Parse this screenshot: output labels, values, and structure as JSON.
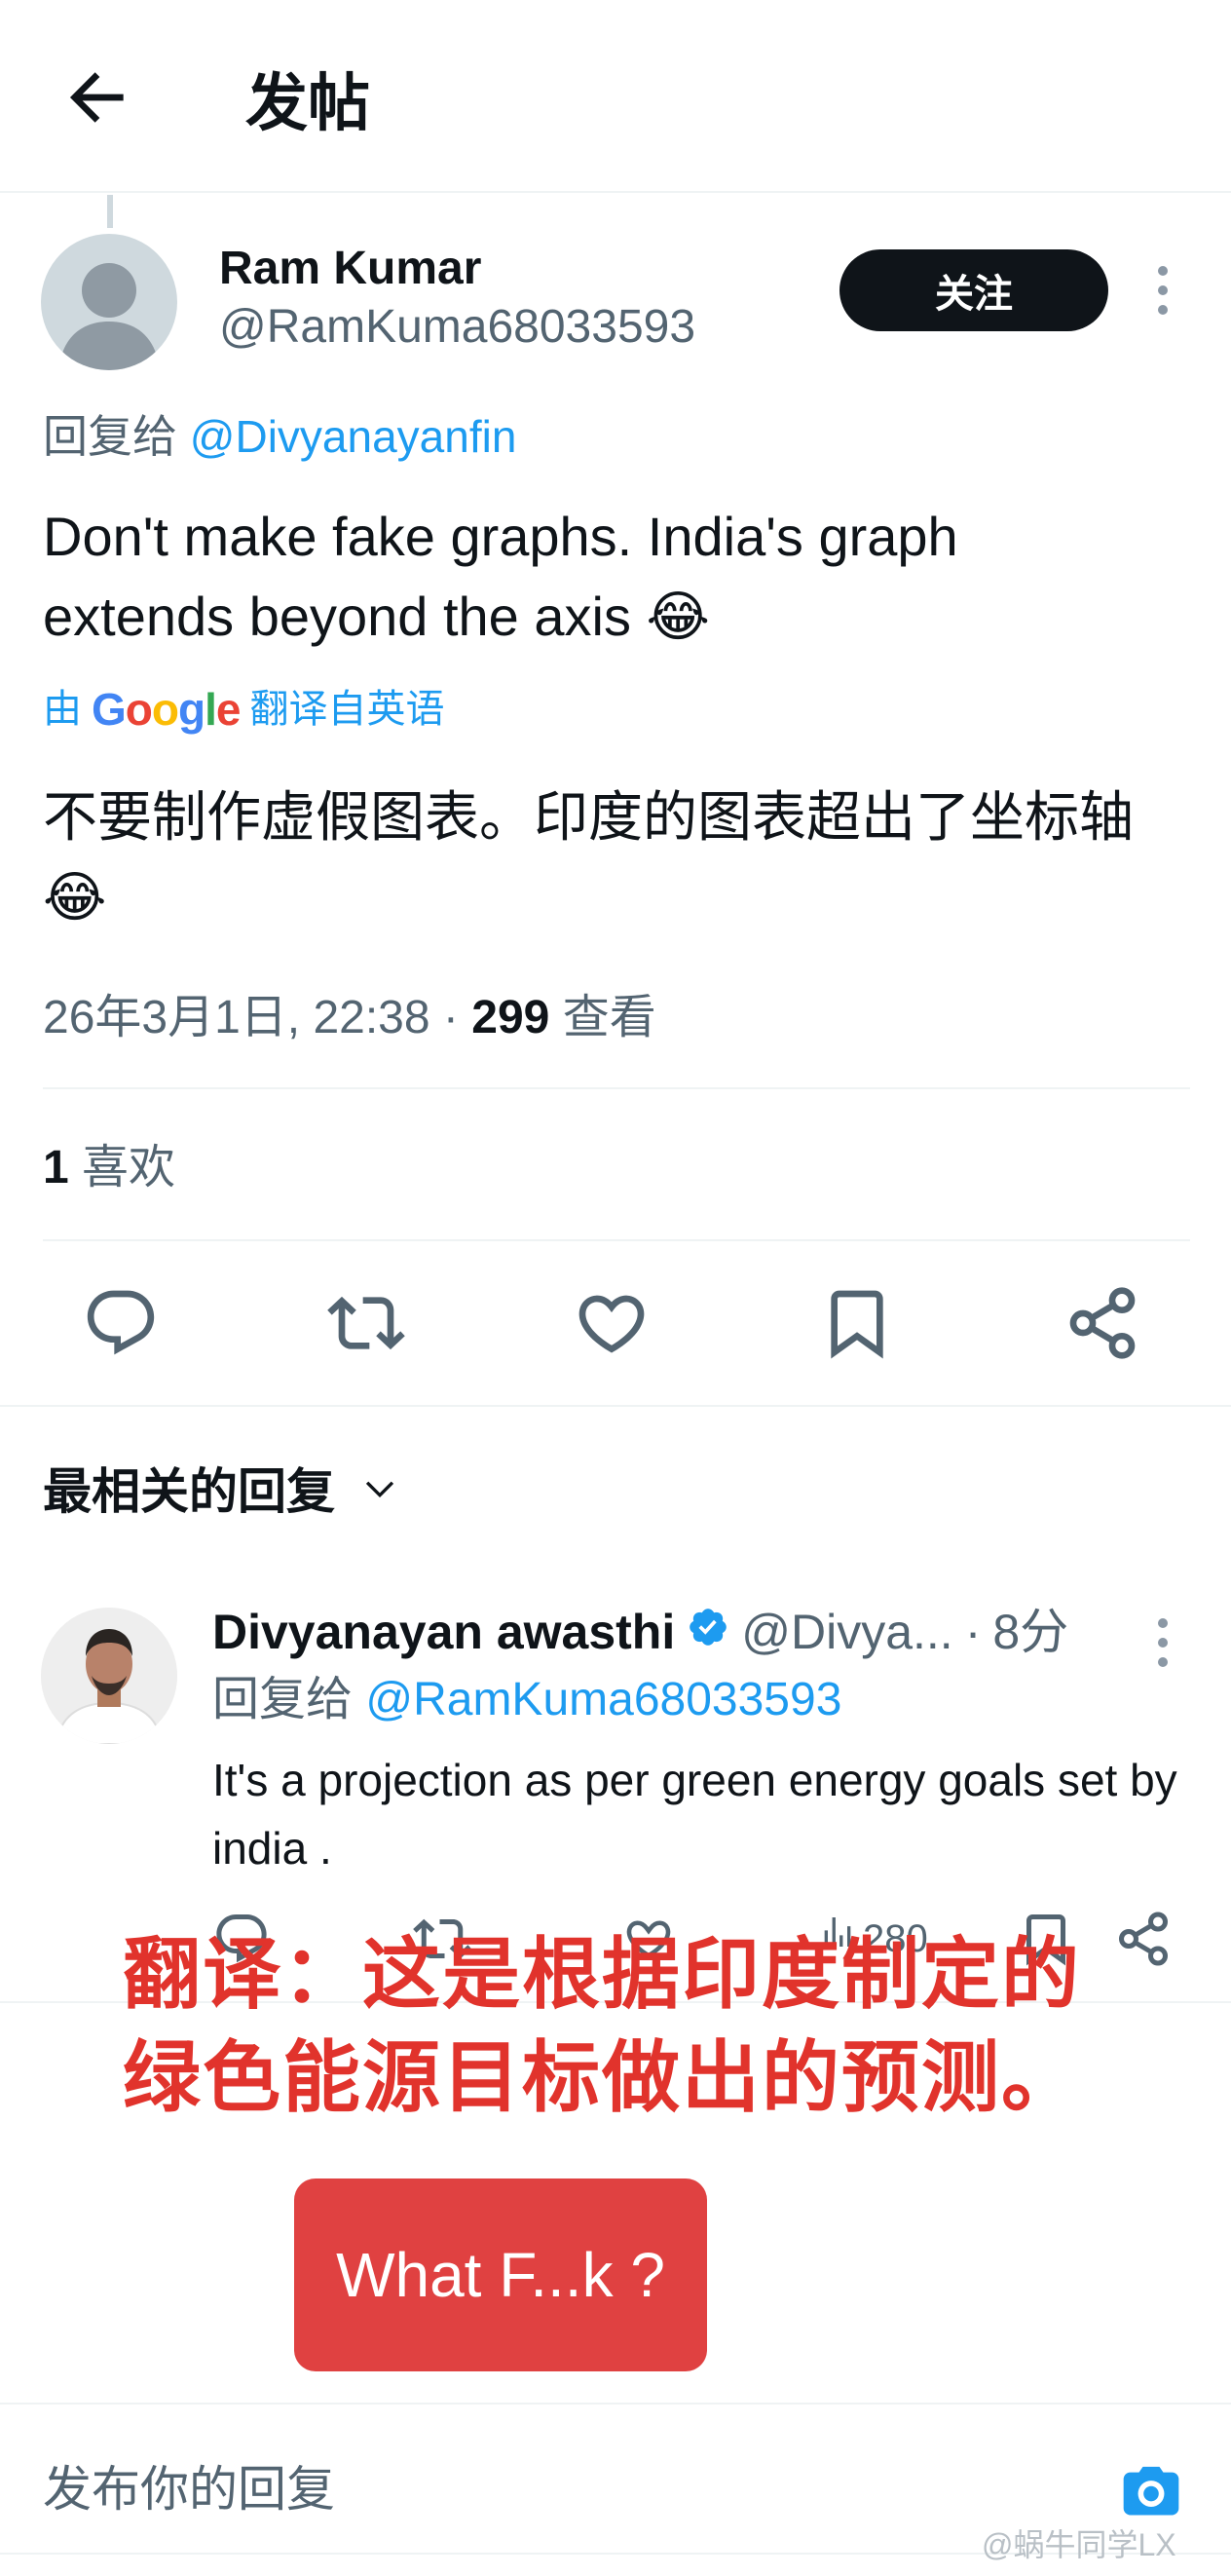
{
  "header": {
    "title": "发帖"
  },
  "tweet": {
    "author_name": "Ram Kumar",
    "author_handle": "@RamKuma68033593",
    "follow_label": "关注",
    "reply_to_prefix": "回复给",
    "reply_to_handle": "@Divyanayanfin",
    "text": "Don't make fake graphs. India's graph extends beyond the axis 😂",
    "translate_by": "由",
    "translate_brand": "Google",
    "translate_suffix": "翻译自英语",
    "translated_text": "不要制作虚假图表。印度的图表超出了坐标轴😂",
    "timestamp": "26年3月1日, 22:38",
    "separator": "·",
    "views_count": "299",
    "views_label": "查看",
    "likes_count": "1",
    "likes_label": "喜欢"
  },
  "replies_section": {
    "title": "最相关的回复"
  },
  "reply": {
    "name": "Divyanayan awasthi",
    "handle": "@Divya...",
    "separator": "·",
    "time": "8分",
    "reply_to_prefix": "回复给",
    "reply_to_handle": "@RamKuma68033593",
    "text": "It's a projection as per green energy goals set by india .",
    "views_count": "280"
  },
  "overlay": {
    "line1": "翻译：这是根据印度制定的",
    "line2": "绿色能源目标做出的预测。",
    "wtf_label": "What F...k ?"
  },
  "compose": {
    "placeholder": "发布你的回复"
  },
  "watermark": "@蜗牛同学LX",
  "colors": {
    "accent": "#1d9bf0",
    "verified": "#1d9bf0",
    "overlay_red": "#e1332c",
    "wtf_box": "#e04141"
  }
}
